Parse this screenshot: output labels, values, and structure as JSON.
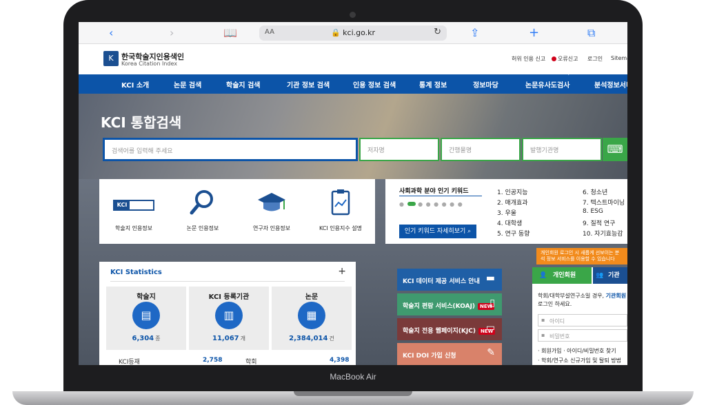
{
  "device": {
    "label": "MacBook Air"
  },
  "browser": {
    "text_size": "AA",
    "url": "kci.go.kr",
    "icons": [
      "back-icon",
      "forward-icon",
      "bookmarks-icon",
      "share-icon",
      "new-tab-icon",
      "tabs-icon",
      "lock-icon",
      "reload-icon"
    ]
  },
  "site": {
    "logo_ko": "한국학술지인용색인",
    "logo_en": "Korea Citation Index",
    "util": {
      "false_cite": "허위 인용 신고",
      "error_report": "오류신고",
      "login": "로그인",
      "sitemap": "Sitemap"
    },
    "nav": [
      "KCI 소개",
      "논문 검색",
      "학술지 검색",
      "기관 정보 검색",
      "인용 정보 검색",
      "통계 정보",
      "정보마당",
      "논문유사도검사",
      "분석정보서비"
    ]
  },
  "search": {
    "title": "KCI 통합검색",
    "main_placeholder": "검색어를 입력해 주세요",
    "author_placeholder": "저자명",
    "journal_placeholder": "간행물명",
    "publisher_placeholder": "발행기관명"
  },
  "quick_links": [
    {
      "label": "학술지 인용정보",
      "icon": "kci-badge-icon",
      "badge": "KCI"
    },
    {
      "label": "논문 인용정보",
      "icon": "magnifier-icon"
    },
    {
      "label": "연구자 인용정보",
      "icon": "graduation-cap-icon"
    },
    {
      "label": "KCI 인용지수 설명",
      "icon": "clipboard-chart-icon"
    }
  ],
  "keywords": {
    "title": "사회과학 분야 인기 키워드",
    "button": "인기 키워드 자세히보기",
    "active_page": 2,
    "pages": 8,
    "left": [
      "1. 인공지능",
      "2. 매개효과",
      "3. 우울",
      "4. 대학생",
      "5. 연구 동향"
    ],
    "right": [
      "6. 청소년",
      "7. 텍스트마이닝",
      "8. ESG",
      "9. 질적 연구",
      "10. 자기효능감"
    ]
  },
  "stats": {
    "title": "KCI Statistics",
    "plus": "+",
    "cards": [
      {
        "label": "학술지",
        "value": "6,304",
        "unit": "종",
        "icon": "books-icon"
      },
      {
        "label": "KCI 등록기관",
        "value": "11,067",
        "unit": "개",
        "icon": "building-icon"
      },
      {
        "label": "논문",
        "value": "2,384,014",
        "unit": "건",
        "icon": "document-icon"
      }
    ],
    "row": {
      "k1": "KCI등재",
      "v1": "2,758",
      "k2": "학회",
      "v2": "4,398"
    }
  },
  "services": [
    {
      "label": "KCI 데이터 제공 서비스 안내",
      "icon": "folder-icon",
      "new": "",
      "color": "#1f5fa6"
    },
    {
      "label": "학술지 편람 서비스(KOAJ)",
      "icon": "page-icon",
      "new": "NEW",
      "color": "#3f9a6f"
    },
    {
      "label": "학술지 전용 웹페이지(KJC)",
      "icon": "monitor-icon",
      "new": "NEW",
      "color": "#7a3a3a"
    },
    {
      "label": "KCI DOI 가입 신청",
      "icon": "pen-icon",
      "new": "",
      "color": "#d9826a"
    }
  ],
  "login": {
    "tooltip": "개인회원 로그인 시 새롭게 선보이는 분석 정보 서비스를 이용할 수 있습니다",
    "tab_personal": "개인회원",
    "tab_org": "기관",
    "note_pre": "학회/대학부설연구소일 경우,",
    "note_link": "기관회원",
    "note_post": "로그인 하세요.",
    "id_placeholder": "아이디",
    "pw_placeholder": "비밀번호",
    "links": [
      "· 회원가입  · 아이디/비밀번호 찾기",
      "· 학회/연구소 신규가입 및 탈퇴 방법"
    ]
  },
  "colors": {
    "primary": "#0c54a8",
    "green": "#3aa648",
    "orange": "#f28b1c",
    "red": "#d0021b"
  }
}
